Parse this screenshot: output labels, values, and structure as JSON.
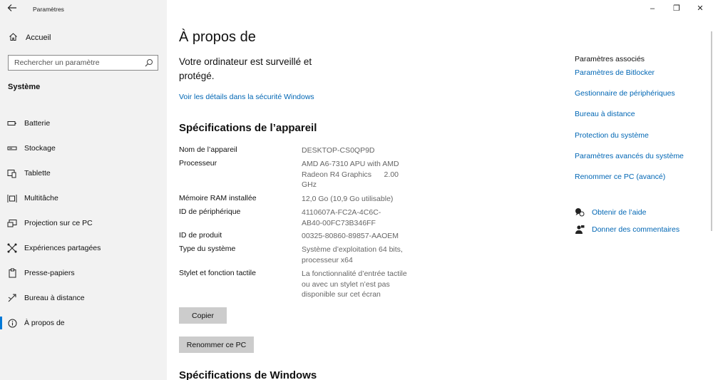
{
  "window": {
    "app_title": "Paramètres",
    "minimize_glyph": "–",
    "restore_glyph": "❐",
    "close_glyph": "✕"
  },
  "sidebar": {
    "home_label": "Accueil",
    "search_placeholder": "Rechercher un paramètre",
    "section_header": "Système",
    "items": [
      {
        "label": "Batterie",
        "icon": "battery-icon"
      },
      {
        "label": "Stockage",
        "icon": "storage-icon"
      },
      {
        "label": "Tablette",
        "icon": "tablet-icon"
      },
      {
        "label": "Multitâche",
        "icon": "multitasking-icon"
      },
      {
        "label": "Projection sur ce PC",
        "icon": "projection-icon"
      },
      {
        "label": "Expériences partagées",
        "icon": "shared-experiences-icon"
      },
      {
        "label": "Presse-papiers",
        "icon": "clipboard-icon"
      },
      {
        "label": "Bureau à distance",
        "icon": "remote-desktop-icon"
      },
      {
        "label": "À propos de",
        "icon": "info-icon",
        "active": true
      }
    ]
  },
  "main": {
    "title": "À propos de",
    "status_line1": "Votre ordinateur est surveillé et",
    "status_line2": "protégé.",
    "security_link": "Voir les détails dans la sécurité Windows",
    "device_specs_title": "Spécifications de l’appareil",
    "specs": [
      {
        "key": "Nom de l’appareil",
        "value": "DESKTOP-CS0QP9D"
      },
      {
        "key": "Processeur",
        "value": "AMD A6-7310 APU with AMD Radeon R4 Graphics      2.00 GHz"
      },
      {
        "key": "Mémoire RAM installée",
        "value": "12,0 Go (10,9 Go utilisable)"
      },
      {
        "key": "ID de périphérique",
        "value": "4110607A-FC2A-4C6C-AB40-00FC73B346FF"
      },
      {
        "key": "ID de produit",
        "value": "00325-80860-89857-AAOEM"
      },
      {
        "key": "Type du système",
        "value": "Système d’exploitation 64 bits, processeur x64"
      },
      {
        "key": "Stylet et fonction tactile",
        "value": "La fonctionnalité d’entrée tactile ou avec un stylet n’est pas disponible sur cet écran"
      }
    ],
    "copy_button": "Copier",
    "rename_button": "Renommer ce PC",
    "windows_specs_title": "Spécifications de Windows"
  },
  "related": {
    "header": "Paramètres associés",
    "links": [
      "Paramètres de Bitlocker",
      "Gestionnaire de périphériques",
      "Bureau à distance",
      "Protection du système",
      "Paramètres avancés du système",
      "Renommer ce PC (avancé)"
    ],
    "help_label": "Obtenir de l’aide",
    "feedback_label": "Donner des commentaires"
  },
  "colors": {
    "accent": "#0078d7",
    "link": "#0066b4",
    "sidebar_bg": "#f2f2f2",
    "button_bg": "#cccccc",
    "value_text": "#666666"
  }
}
